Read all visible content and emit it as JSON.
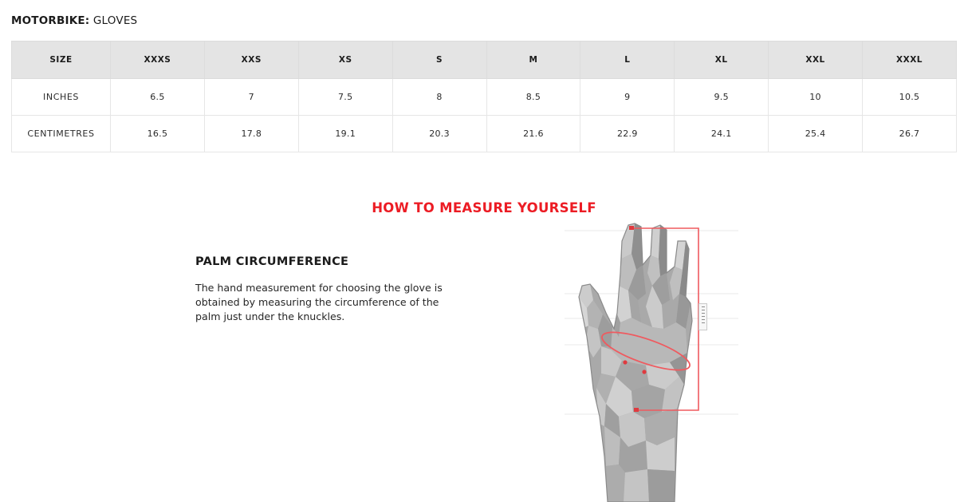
{
  "header": {
    "category": "MOTORBIKE:",
    "product": "GLOVES"
  },
  "size_table": {
    "columns": [
      "SIZE",
      "XXXS",
      "XXS",
      "XS",
      "S",
      "M",
      "L",
      "XL",
      "XXL",
      "XXXL"
    ],
    "rows": [
      {
        "label": "INCHES",
        "values": [
          "6.5",
          "7",
          "7.5",
          "8",
          "8.5",
          "9",
          "9.5",
          "10",
          "10.5"
        ]
      },
      {
        "label": "CENTIMETRES",
        "values": [
          "16.5",
          "17.8",
          "19.1",
          "20.3",
          "21.6",
          "22.9",
          "24.1",
          "25.4",
          "26.7"
        ]
      }
    ],
    "header_background": "#e4e4e4",
    "border_color": "#e6e6e6"
  },
  "measure_section": {
    "heading": "HOW TO MEASURE YOURSELF",
    "heading_color": "#ec1c24",
    "subheading": "PALM CIRCUMFERENCE",
    "description": "The hand measurement for choosing the glove is obtained by measuring the circumference of the palm just under the knuckles.",
    "illustration": {
      "name": "hand-diagram",
      "annotation_color": "#e8ararar",
      "measure_line_color": "#ef5a5f",
      "hand_fill": "#a8a8a8"
    }
  }
}
